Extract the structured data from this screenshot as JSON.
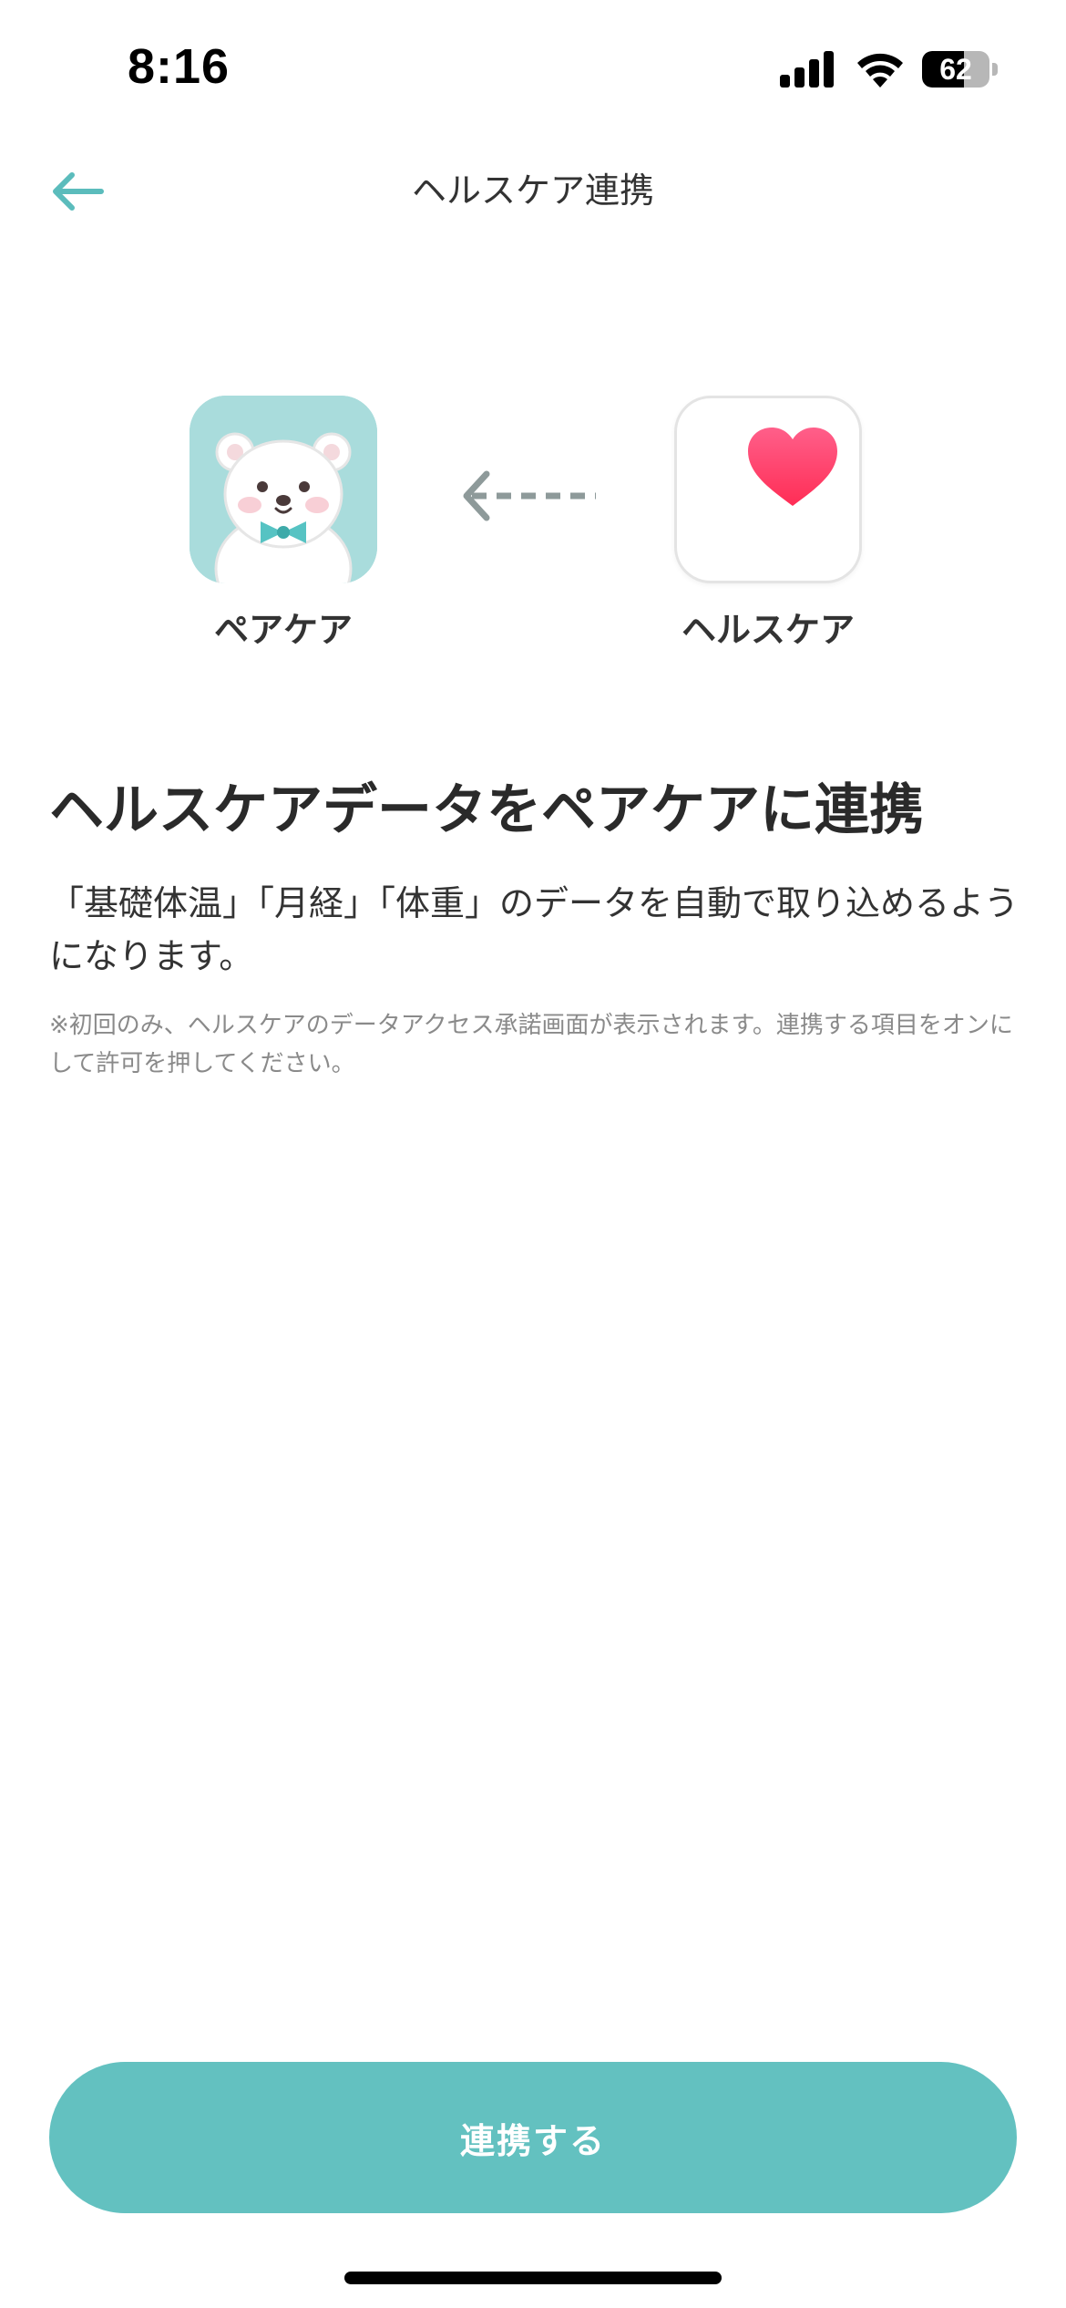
{
  "status_bar": {
    "time": "8:16",
    "battery_percent": "62",
    "battery_level": 0.62
  },
  "nav": {
    "title": "ヘルスケア連携",
    "back_icon": "arrow-left-icon",
    "accent_color": "#5bbcbc"
  },
  "illustration": {
    "source_app": "ヘルスケア",
    "target_app": "ペアケア",
    "source_icon": "heart-icon",
    "target_icon": "polar-bear-icon",
    "direction_icon": "dashed-arrow-left-icon"
  },
  "main": {
    "headline": "ヘルスケアデータをペアケアに連携",
    "description": "「基礎体温」「月経」「体重」のデータを自動で取り込めるようになります。",
    "note": "※初回のみ、ヘルスケアのデータアクセス承諾画面が表示されます。連携する項目をオンにして許可を押してください。"
  },
  "actions": {
    "connect_label": "連携する",
    "button_color": "#63c1c0"
  }
}
